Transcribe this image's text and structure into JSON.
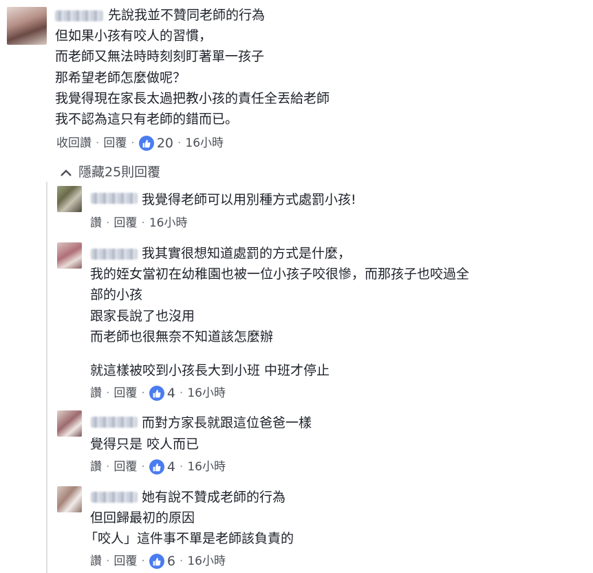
{
  "main_comment": {
    "lines": [
      "先說我並不贊同老師的行為",
      "但如果小孩有咬人的習慣，",
      "而老師又無法時時刻刻盯著單一孩子",
      "那希望老師怎麼做呢？",
      "我覺得現在家長太過把教小孩的責任全丟給老師",
      "我不認為這只有老師的錯而已。"
    ],
    "actions": {
      "like": "收回讚",
      "reply": "回覆",
      "likes": "20",
      "time": "16小時"
    }
  },
  "hide_replies": {
    "icon": "chevron-up-icon",
    "label": "隱藏25則回覆"
  },
  "replies": [
    {
      "lines": [
        "我覺得老師可以用別種方式處罰小孩!"
      ],
      "actions": {
        "like": "讚",
        "reply": "回覆",
        "likes": "",
        "time": "16小時"
      }
    },
    {
      "lines": [
        "我其實很想知道處罰的方式是什麼，",
        "我的姪女當初在幼稚園也被一位小孩子咬很慘，而那孩子也咬過全",
        "部的小孩",
        "跟家長說了也沒用",
        "而老師也很無奈不知道該怎麼辦",
        "",
        "就這樣被咬到小孩長大到小班 中班才停止"
      ],
      "actions": {
        "like": "讚",
        "reply": "回覆",
        "likes": "4",
        "time": "16小時"
      }
    },
    {
      "lines": [
        "而對方家長就跟這位爸爸一樣",
        "覺得只是 咬人而已"
      ],
      "actions": {
        "like": "讚",
        "reply": "回覆",
        "likes": "4",
        "time": "16小時"
      }
    },
    {
      "lines": [
        "她有說不贊成老師的行為",
        "但回歸最初的原因",
        "「咬人」這件事不單是老師該負責的"
      ],
      "actions": {
        "like": "讚",
        "reply": "回覆",
        "likes": "6",
        "time": "16小時"
      }
    }
  ],
  "colors": {
    "like_blue": "#4a7cf0",
    "meta_gray": "#90949c",
    "text": "#1d2129"
  }
}
